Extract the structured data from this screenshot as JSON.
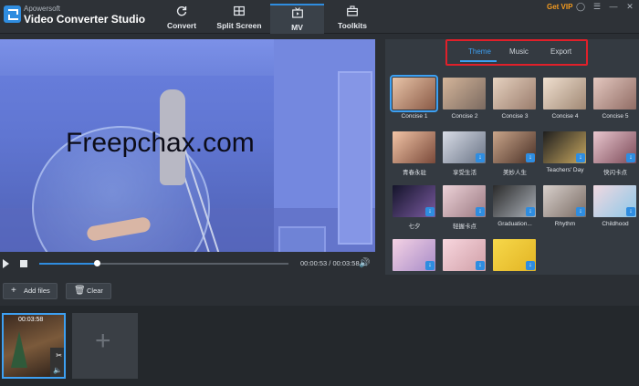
{
  "app": {
    "brand": "Apowersoft",
    "title": "Video Converter Studio",
    "logo_icon": "convert-logo-icon"
  },
  "nav": {
    "tabs": [
      {
        "label": "Convert",
        "icon": "refresh-icon",
        "active": false
      },
      {
        "label": "Split Screen",
        "icon": "split-screen-icon",
        "active": false
      },
      {
        "label": "MV",
        "icon": "tv-icon",
        "active": true
      },
      {
        "label": "Toolkits",
        "icon": "toolbox-icon",
        "active": false
      }
    ]
  },
  "window": {
    "get_vip": "Get VIP",
    "controls": [
      "user-icon",
      "list-icon",
      "minimize-icon",
      "close-icon"
    ]
  },
  "preview": {
    "watermark": "Freepchax.com"
  },
  "player": {
    "progress": 0.23,
    "time": "00:00:53 / 00:03:58"
  },
  "panel": {
    "subtabs": [
      "Theme",
      "Music",
      "Export"
    ],
    "active_subtab": "Theme",
    "highlight_color": "#e0202a",
    "themes": [
      {
        "label": "Concise 1",
        "selected": true,
        "download": false
      },
      {
        "label": "Concise 2",
        "selected": false,
        "download": false
      },
      {
        "label": "Concise 3",
        "selected": false,
        "download": false
      },
      {
        "label": "Concise 4",
        "selected": false,
        "download": false
      },
      {
        "label": "Concise 5",
        "selected": false,
        "download": false
      },
      {
        "label": "青春永驻",
        "selected": false,
        "download": false
      },
      {
        "label": "享受生活",
        "selected": false,
        "download": true
      },
      {
        "label": "美妙人生",
        "selected": false,
        "download": true
      },
      {
        "label": "Teachers' Day",
        "selected": false,
        "download": true
      },
      {
        "label": "快闪卡点",
        "selected": false,
        "download": true
      },
      {
        "label": "七夕",
        "selected": false,
        "download": true
      },
      {
        "label": "轻握卡点",
        "selected": false,
        "download": true
      },
      {
        "label": "Graduation...",
        "selected": false,
        "download": true
      },
      {
        "label": "Rhythm",
        "selected": false,
        "download": true
      },
      {
        "label": "Childhood",
        "selected": false,
        "download": true
      },
      {
        "label": "",
        "selected": false,
        "download": true
      },
      {
        "label": "",
        "selected": false,
        "download": true
      },
      {
        "label": "",
        "selected": false,
        "download": true
      }
    ]
  },
  "toolbar": {
    "add_files": "Add files",
    "clear": "Clear"
  },
  "media": {
    "clip_duration": "00:03:58"
  }
}
